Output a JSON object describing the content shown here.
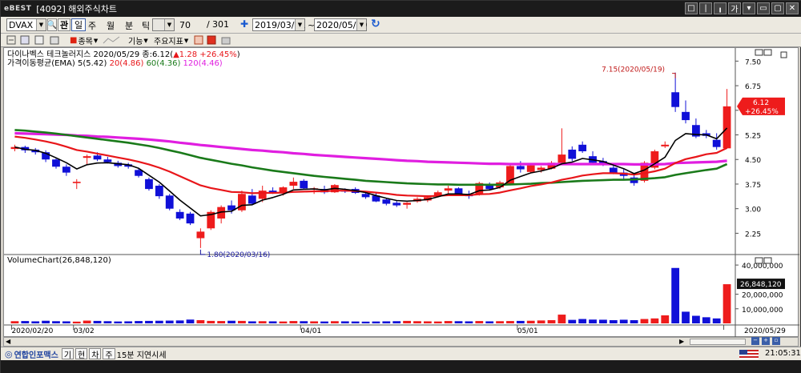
{
  "window": {
    "brand": "eBEST",
    "title": "[4092] 해외주식차트",
    "buttons": [
      "□",
      "|",
      "╻",
      "가",
      "▾",
      "▭",
      "▢",
      "✕"
    ]
  },
  "toolbar": {
    "symbol": "DVAX",
    "periods": [
      "관",
      "일",
      "주",
      "월",
      "분",
      "틱"
    ],
    "active_period": "일",
    "count": "70",
    "slash": "/",
    "total": "301",
    "plus": "✚",
    "start_date": "2019/03/21",
    "tilde": "~",
    "end_date": "2020/05/29",
    "refresh": "↻"
  },
  "toolbar2": {
    "items": [
      "종목",
      "기능",
      "주요지표"
    ]
  },
  "chart": {
    "title": "다이나벡스 테크놀러지스  2020/05/29 종:6.12(▲1.28 +26.45%)",
    "title_name": "다이나벡스 테크놀러지스",
    "title_date": "2020/05/29",
    "title_close_label": "종:6.12(",
    "title_change": "▲1.28 +26.45%",
    "title_close_paren": ")",
    "ema_label": "가격이동평균(EMA)",
    "ema_entries": [
      {
        "text": "5(5.42)",
        "color": "#000000"
      },
      {
        "text": "20(4.86)",
        "color": "#e8161a"
      },
      {
        "text": "60(4.36)",
        "color": "#1a7a1a"
      },
      {
        "text": "120(4.46)",
        "color": "#e01ee0"
      }
    ],
    "volume_label": "VolumeChart(26,848,120)",
    "high_annotation": "7.15(2020/05/19)",
    "low_annotation": "1.80(2020/03/16)",
    "price_ticks": [
      "7.50",
      "6.75",
      "6.00",
      "5.25",
      "4.50",
      "3.75",
      "3.00",
      "2.25"
    ],
    "price_tick_values": [
      7.5,
      6.75,
      6.0,
      5.25,
      4.5,
      3.75,
      3.0,
      2.25
    ],
    "price_range": [
      1.65,
      7.85
    ],
    "current_price": "6.12",
    "current_change": "+26.45%",
    "volume_ticks": [
      "40,000,000",
      "20,000,000",
      "10,000,000"
    ],
    "volume_tick_values": [
      40000000,
      20000000,
      10000000
    ],
    "volume_range": [
      0,
      45000000
    ],
    "current_volume": "26,848,120",
    "date_labels": [
      {
        "text": "2020/02/20",
        "index": 0
      },
      {
        "text": "03/02",
        "index": 6
      },
      {
        "text": "04/01",
        "index": 28
      },
      {
        "text": "05/01",
        "index": 49
      },
      {
        "text": "2020/05/29",
        "index": 69
      }
    ],
    "colors": {
      "up": "#ee1c1c",
      "down": "#1010d8",
      "ema5": "#000000",
      "ema20": "#e8161a",
      "ema60": "#1a7a1a",
      "ema120": "#e01ee0"
    }
  },
  "chart_data": {
    "type": "candlestick",
    "title": "다이나벡스 테크놀러지스",
    "x_start": "2020/02/20",
    "x_end": "2020/05/29",
    "ohlc": [
      [
        4.82,
        4.95,
        4.75,
        4.88
      ],
      [
        4.88,
        4.92,
        4.7,
        4.78
      ],
      [
        4.8,
        4.85,
        4.65,
        4.72
      ],
      [
        4.72,
        4.78,
        4.42,
        4.5
      ],
      [
        4.5,
        4.55,
        4.22,
        4.28
      ],
      [
        4.28,
        4.35,
        4.0,
        4.1
      ],
      [
        3.78,
        3.9,
        3.6,
        3.82
      ],
      [
        4.55,
        4.65,
        4.35,
        4.6
      ],
      [
        4.62,
        4.72,
        4.45,
        4.5
      ],
      [
        4.5,
        4.58,
        4.38,
        4.42
      ],
      [
        4.4,
        4.46,
        4.25,
        4.3
      ],
      [
        4.35,
        4.4,
        4.22,
        4.28
      ],
      [
        4.18,
        4.25,
        3.95,
        4.0
      ],
      [
        3.9,
        3.95,
        3.55,
        3.6
      ],
      [
        3.7,
        3.75,
        3.3,
        3.38
      ],
      [
        3.4,
        3.45,
        2.95,
        3.0
      ],
      [
        2.9,
        2.98,
        2.65,
        2.7
      ],
      [
        2.85,
        2.9,
        2.5,
        2.55
      ],
      [
        2.1,
        2.4,
        1.8,
        2.3
      ],
      [
        2.4,
        2.95,
        2.35,
        2.9
      ],
      [
        2.7,
        3.1,
        2.55,
        3.05
      ],
      [
        3.1,
        3.25,
        2.85,
        2.95
      ],
      [
        2.95,
        3.55,
        2.9,
        3.45
      ],
      [
        3.4,
        3.6,
        3.1,
        3.15
      ],
      [
        3.3,
        3.7,
        3.2,
        3.55
      ],
      [
        3.55,
        3.65,
        3.45,
        3.5
      ],
      [
        3.5,
        3.68,
        3.4,
        3.65
      ],
      [
        3.7,
        3.95,
        3.6,
        3.82
      ],
      [
        3.85,
        3.9,
        3.6,
        3.62
      ],
      [
        3.58,
        3.66,
        3.45,
        3.62
      ],
      [
        3.6,
        3.7,
        3.45,
        3.5
      ],
      [
        3.5,
        3.75,
        3.48,
        3.72
      ],
      [
        3.55,
        3.62,
        3.48,
        3.52
      ],
      [
        3.6,
        3.65,
        3.45,
        3.48
      ],
      [
        3.45,
        3.5,
        3.3,
        3.35
      ],
      [
        3.4,
        3.48,
        3.2,
        3.22
      ],
      [
        3.28,
        3.32,
        3.1,
        3.15
      ],
      [
        3.18,
        3.25,
        3.05,
        3.1
      ],
      [
        3.12,
        3.2,
        3.0,
        3.18
      ],
      [
        3.22,
        3.35,
        3.18,
        3.3
      ],
      [
        3.25,
        3.4,
        3.2,
        3.35
      ],
      [
        3.4,
        3.55,
        3.35,
        3.5
      ],
      [
        3.55,
        3.7,
        3.45,
        3.62
      ],
      [
        3.62,
        3.65,
        3.4,
        3.45
      ],
      [
        3.45,
        3.55,
        3.3,
        3.38
      ],
      [
        3.45,
        3.82,
        3.4,
        3.78
      ],
      [
        3.75,
        3.8,
        3.55,
        3.6
      ],
      [
        3.65,
        3.85,
        3.6,
        3.8
      ],
      [
        3.75,
        4.35,
        3.72,
        4.3
      ],
      [
        4.3,
        4.45,
        4.1,
        4.2
      ],
      [
        4.12,
        4.35,
        4.08,
        4.32
      ],
      [
        4.18,
        4.3,
        4.1,
        4.25
      ],
      [
        4.22,
        4.45,
        4.2,
        4.4
      ],
      [
        4.4,
        5.45,
        4.35,
        4.65
      ],
      [
        4.8,
        4.9,
        4.45,
        4.52
      ],
      [
        4.95,
        5.05,
        4.7,
        4.75
      ],
      [
        4.6,
        4.75,
        4.35,
        4.4
      ],
      [
        4.45,
        4.55,
        4.3,
        4.35
      ],
      [
        4.25,
        4.32,
        4.05,
        4.1
      ],
      [
        4.1,
        4.2,
        3.9,
        4.0
      ],
      [
        3.95,
        4.02,
        3.7,
        3.78
      ],
      [
        3.85,
        4.45,
        3.8,
        4.4
      ],
      [
        4.25,
        4.8,
        4.2,
        4.75
      ],
      [
        4.9,
        5.05,
        4.85,
        4.95
      ],
      [
        6.55,
        7.15,
        5.95,
        6.1
      ],
      [
        5.95,
        6.3,
        5.6,
        5.7
      ],
      [
        5.55,
        5.75,
        5.15,
        5.2
      ],
      [
        5.3,
        5.4,
        5.15,
        5.22
      ],
      [
        5.1,
        5.3,
        4.8,
        4.88
      ],
      [
        4.84,
        6.65,
        4.84,
        6.12
      ]
    ],
    "volume": [
      1500000,
      1600000,
      1400000,
      1800000,
      1500000,
      1400000,
      1200000,
      1900000,
      1700000,
      1500000,
      1300000,
      1400000,
      1600000,
      1700000,
      1800000,
      1900000,
      2000000,
      2600000,
      2200000,
      1700000,
      1600000,
      1800000,
      1700000,
      1400000,
      1500000,
      1400000,
      1300000,
      1600000,
      1500000,
      1400000,
      1300000,
      1500000,
      1400000,
      1300000,
      1200000,
      1300000,
      1400000,
      1500000,
      1700000,
      1500000,
      1400000,
      1300000,
      1600000,
      1500000,
      1400000,
      1600000,
      1400000,
      1500000,
      1600000,
      1700000,
      1800000,
      2000000,
      2200000,
      6000000,
      2400000,
      3000000,
      2600000,
      2500000,
      2200000,
      2500000,
      2200000,
      3000000,
      3400000,
      5500000,
      38000000,
      8000000,
      5200000,
      4200000,
      3400000,
      26848120
    ],
    "series": [
      {
        "name": "5",
        "values": [
          4.88,
          4.81,
          4.78,
          4.69,
          4.55,
          4.4,
          4.21,
          4.34,
          4.39,
          4.4,
          4.37,
          4.34,
          4.23,
          4.02,
          3.81,
          3.54,
          3.26,
          3.02,
          2.78,
          2.82,
          2.9,
          2.92,
          3.1,
          3.12,
          3.26,
          3.34,
          3.44,
          3.57,
          3.59,
          3.6,
          3.57,
          3.62,
          3.59,
          3.55,
          3.49,
          3.4,
          3.32,
          3.25,
          3.23,
          3.25,
          3.28,
          3.36,
          3.45,
          3.45,
          3.43,
          3.55,
          3.57,
          3.65,
          3.87,
          3.98,
          4.09,
          4.15,
          4.23,
          4.37,
          4.42,
          4.53,
          4.49,
          4.44,
          4.33,
          4.22,
          4.07,
          4.18,
          4.37,
          4.57,
          5.08,
          5.29,
          5.26,
          5.25,
          5.13,
          5.46
        ]
      },
      {
        "name": "20",
        "values": [
          5.2,
          5.16,
          5.11,
          5.05,
          4.98,
          4.89,
          4.79,
          4.74,
          4.68,
          4.62,
          4.56,
          4.5,
          4.43,
          4.35,
          4.25,
          4.13,
          3.99,
          3.85,
          3.71,
          3.63,
          3.57,
          3.51,
          3.5,
          3.47,
          3.48,
          3.48,
          3.49,
          3.51,
          3.52,
          3.53,
          3.53,
          3.55,
          3.55,
          3.54,
          3.52,
          3.49,
          3.46,
          3.42,
          3.4,
          3.39,
          3.38,
          3.39,
          3.41,
          3.41,
          3.41,
          3.44,
          3.45,
          3.49,
          3.56,
          3.62,
          3.69,
          3.74,
          3.8,
          3.88,
          3.94,
          4.01,
          4.05,
          4.08,
          4.08,
          4.07,
          4.04,
          4.08,
          4.14,
          4.22,
          4.39,
          4.51,
          4.58,
          4.66,
          4.7,
          4.85
        ]
      },
      {
        "name": "60",
        "values": [
          5.4,
          5.38,
          5.35,
          5.32,
          5.29,
          5.25,
          5.21,
          5.17,
          5.13,
          5.09,
          5.05,
          5.01,
          4.96,
          4.91,
          4.85,
          4.78,
          4.71,
          4.63,
          4.55,
          4.49,
          4.43,
          4.37,
          4.32,
          4.26,
          4.21,
          4.16,
          4.12,
          4.08,
          4.04,
          4.0,
          3.97,
          3.94,
          3.91,
          3.88,
          3.85,
          3.83,
          3.81,
          3.79,
          3.77,
          3.76,
          3.75,
          3.74,
          3.74,
          3.73,
          3.73,
          3.73,
          3.73,
          3.73,
          3.74,
          3.75,
          3.76,
          3.78,
          3.79,
          3.81,
          3.83,
          3.85,
          3.86,
          3.87,
          3.88,
          3.88,
          3.89,
          3.91,
          3.93,
          3.96,
          4.03,
          4.08,
          4.13,
          4.18,
          4.22,
          4.36
        ]
      },
      {
        "name": "120",
        "values": [
          5.3,
          5.29,
          5.28,
          5.27,
          5.26,
          5.25,
          5.23,
          5.22,
          5.2,
          5.19,
          5.17,
          5.15,
          5.13,
          5.11,
          5.08,
          5.05,
          5.01,
          4.98,
          4.94,
          4.91,
          4.88,
          4.85,
          4.82,
          4.79,
          4.77,
          4.74,
          4.72,
          4.69,
          4.67,
          4.64,
          4.62,
          4.6,
          4.58,
          4.56,
          4.54,
          4.52,
          4.5,
          4.48,
          4.46,
          4.45,
          4.43,
          4.42,
          4.41,
          4.4,
          4.39,
          4.38,
          4.37,
          4.37,
          4.36,
          4.36,
          4.36,
          4.36,
          4.36,
          4.36,
          4.36,
          4.36,
          4.36,
          4.36,
          4.36,
          4.36,
          4.35,
          4.35,
          4.35,
          4.36,
          4.39,
          4.4,
          4.41,
          4.42,
          4.43,
          4.46
        ]
      }
    ]
  },
  "statusbar": {
    "logo": "연합인포맥스",
    "chips": [
      "기",
      "현",
      "차",
      "주"
    ],
    "delay_text": "15분 지연시세",
    "time": "21:05:31"
  }
}
